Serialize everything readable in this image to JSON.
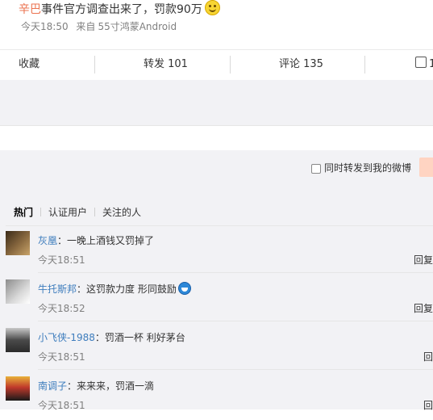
{
  "post": {
    "mention": "辛巴",
    "text": "事件官方调查出来了，罚款90万",
    "time": "今天18:50",
    "source_prefix": "来自",
    "source": "55寸鸿蒙Android"
  },
  "actions": {
    "favorite": "收藏",
    "repost": "转发 101",
    "comment": "评论 135",
    "like": "1"
  },
  "forward_option": "同时转发到我的微博",
  "tabs": [
    "热门",
    "认证用户",
    "关注的人"
  ],
  "comments": [
    {
      "user": "灰凰",
      "text": "一晚上酒钱又罚掉了",
      "time": "今天18:51",
      "reply": "回复",
      "avatar_color": "#7a5c3a"
    },
    {
      "user": "牛托斯邦",
      "text": "这罚款力度 形同鼓励",
      "time": "今天18:52",
      "reply": "回复",
      "avatar_color": "#b8b8b8"
    },
    {
      "user": "小飞侠-1988",
      "text": "罚酒一杯 利好茅台",
      "time": "今天18:51",
      "reply": "回",
      "avatar_color": "#555555"
    },
    {
      "user": "南调子",
      "text": "来来来，罚酒一滴",
      "time": "今天18:51",
      "reply": "回",
      "avatar_color": "#c0392b"
    }
  ],
  "colors": {
    "link": "#3e7dbd",
    "mention": "#eb7350",
    "bg_grey": "#f2f2f5"
  },
  "icons": {
    "post_emoji": "smile-emoji-icon",
    "comment2_emoji": "doraemon-emoji-icon",
    "like": "thumb-up-icon"
  }
}
